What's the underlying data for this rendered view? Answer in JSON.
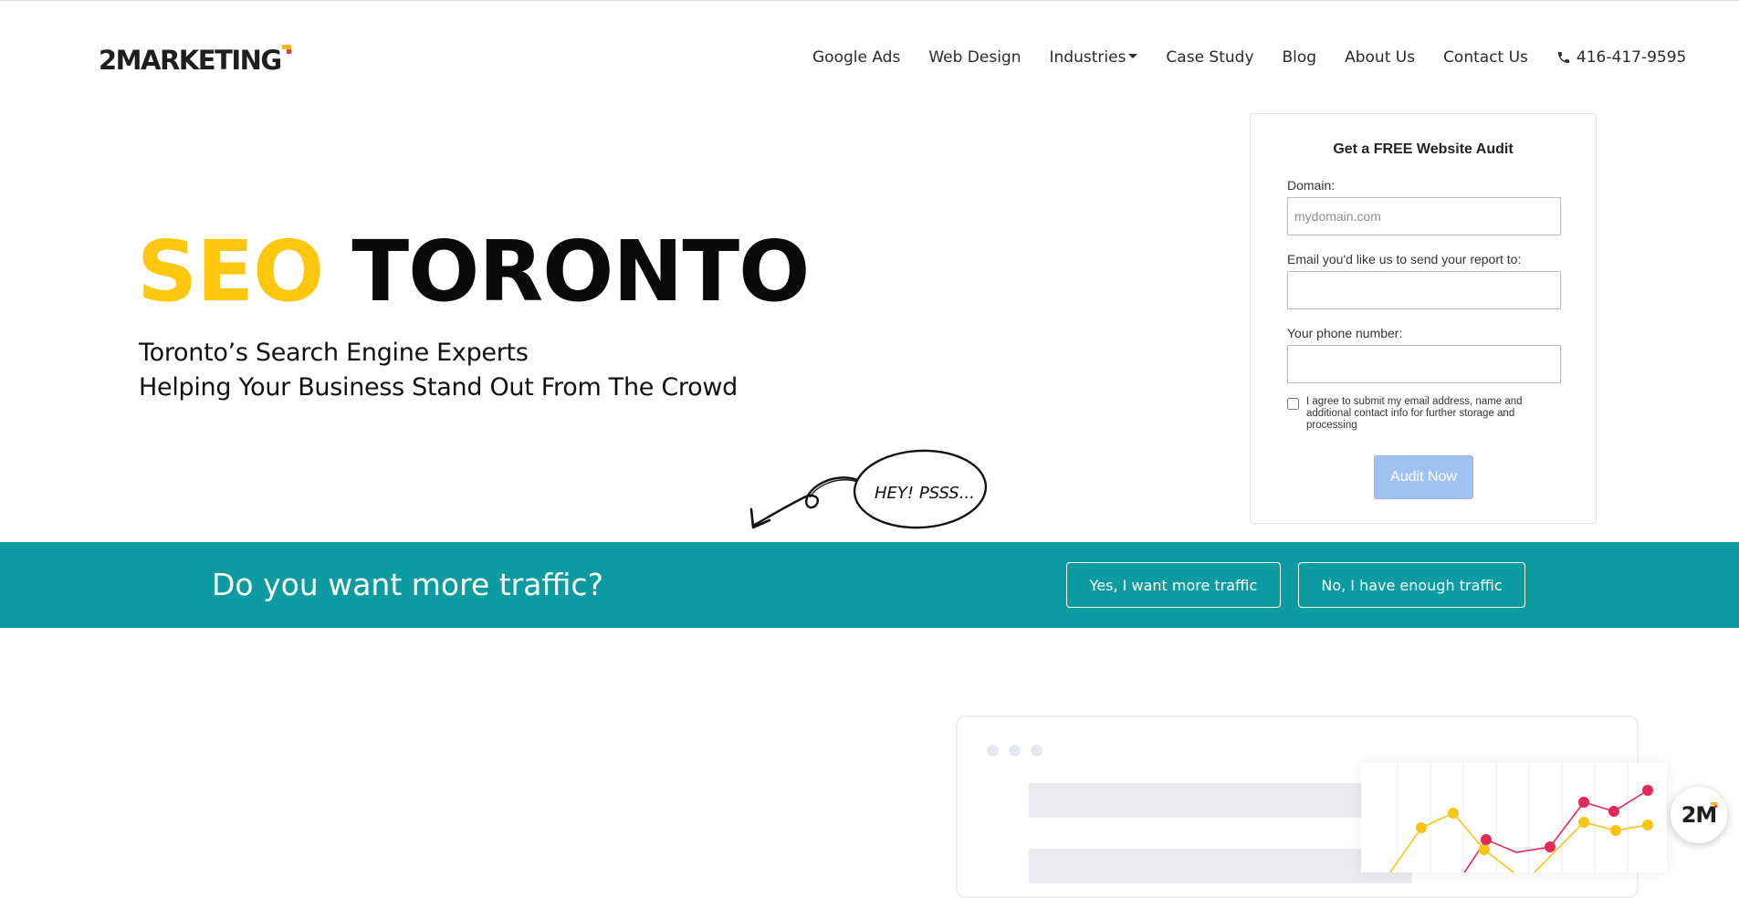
{
  "header": {
    "logo_text": "2MARKETING",
    "nav": [
      "Google Ads",
      "Web Design",
      "Industries",
      "Case Study",
      "Blog",
      "About Us",
      "Contact Us"
    ],
    "phone": "416-417-9595"
  },
  "hero": {
    "title_highlight": "SEO",
    "title_rest": "TORONTO",
    "subtitle_line1": "Toronto’s Search Engine Experts",
    "subtitle_line2": "Helping Your Business Stand Out From The Crowd",
    "doodle_text": "HEY! PSSS..."
  },
  "audit_form": {
    "title": "Get a FREE Website Audit",
    "domain_label": "Domain:",
    "domain_placeholder": "mydomain.com",
    "email_label": "Email you'd like us to send your report to:",
    "phone_label": "Your phone number:",
    "consent_text": "I agree to submit my email address, name and additional contact info for further storage and processing",
    "button_label": "Audit Now"
  },
  "traffic_band": {
    "question": "Do you want more traffic?",
    "yes_label": "Yes, I want more traffic",
    "no_label": "No, I have enough traffic"
  },
  "chat_widget": {
    "label": "2M"
  },
  "colors": {
    "accent_yellow": "#fcc70c",
    "teal": "#0b9ba1",
    "audit_button": "#9fc2f3",
    "chart_pink": "#e5285a",
    "chart_yellow": "#f9c514"
  },
  "icons": [
    "phone-icon",
    "chevron-down-icon",
    "arrow-doodle-icon"
  ]
}
